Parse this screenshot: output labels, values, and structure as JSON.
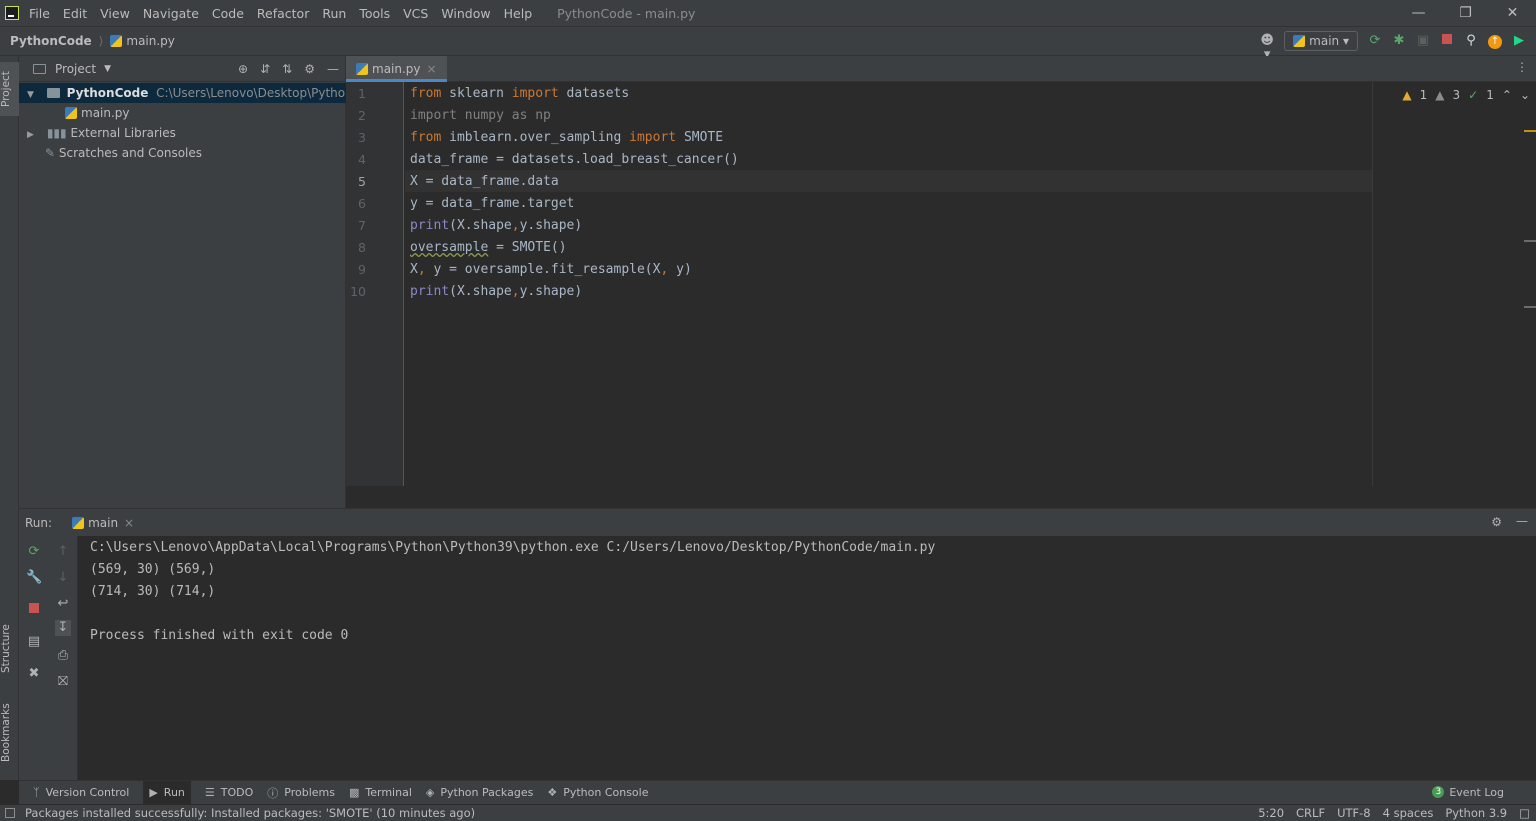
{
  "menu": {
    "items": [
      "File",
      "Edit",
      "View",
      "Navigate",
      "Code",
      "Refactor",
      "Run",
      "Tools",
      "VCS",
      "Window",
      "Help"
    ],
    "window_title": "PythonCode - main.py"
  },
  "navbar": {
    "project": "PythonCode",
    "file": "main.py",
    "run_config": "main"
  },
  "project_panel": {
    "title": "Project",
    "root_name": "PythonCode",
    "root_path": "C:\\Users\\Lenovo\\Desktop\\PythonCode",
    "file": "main.py",
    "external_libraries": "External Libraries",
    "scratches": "Scratches and Consoles"
  },
  "left_stripe": {
    "project": "Project",
    "structure": "Structure",
    "bookmarks": "Bookmarks"
  },
  "editor": {
    "tab": "main.py",
    "line_numbers": [
      "1",
      "2",
      "3",
      "4",
      "5",
      "6",
      "7",
      "8",
      "9",
      "10"
    ],
    "current_line": "5",
    "inspections": {
      "warnings_a": "1",
      "warnings_b": "3",
      "ok": "1"
    },
    "lines": [
      [
        {
          "t": "from",
          "c": "kw"
        },
        {
          "t": " sklearn ",
          "c": ""
        },
        {
          "t": "import",
          "c": "kw"
        },
        {
          "t": " datasets",
          "c": ""
        }
      ],
      [
        {
          "t": "import numpy as np",
          "c": "gray"
        }
      ],
      [
        {
          "t": "from",
          "c": "kw"
        },
        {
          "t": " imblearn.over_sampling ",
          "c": ""
        },
        {
          "t": "import",
          "c": "kw"
        },
        {
          "t": " SMOTE",
          "c": ""
        }
      ],
      [
        {
          "t": "data_frame = datasets.load_breast_cancer()",
          "c": ""
        }
      ],
      [
        {
          "t": "X = data_frame.data",
          "c": ""
        }
      ],
      [
        {
          "t": "y = data_frame.target",
          "c": ""
        }
      ],
      [
        {
          "t": "print",
          "c": "purp"
        },
        {
          "t": "(X.shape",
          "c": ""
        },
        {
          "t": ",",
          "c": "kw"
        },
        {
          "t": "y.shape)",
          "c": ""
        }
      ],
      [
        {
          "t": "oversample",
          "c": "underw"
        },
        {
          "t": " = SMOTE()",
          "c": ""
        }
      ],
      [
        {
          "t": "X",
          "c": ""
        },
        {
          "t": ",",
          "c": "kw"
        },
        {
          "t": " y = oversample.fit_resample(X",
          "c": ""
        },
        {
          "t": ",",
          "c": "kw"
        },
        {
          "t": " y)",
          "c": ""
        }
      ],
      [
        {
          "t": "print",
          "c": "purp"
        },
        {
          "t": "(X.shape",
          "c": ""
        },
        {
          "t": ",",
          "c": "kw"
        },
        {
          "t": "y.shape)",
          "c": ""
        }
      ]
    ]
  },
  "run_panel": {
    "label": "Run:",
    "tab": "main",
    "output": [
      "C:\\Users\\Lenovo\\AppData\\Local\\Programs\\Python\\Python39\\python.exe C:/Users/Lenovo/Desktop/PythonCode/main.py",
      "(569, 30) (569,)",
      "(714, 30) (714,)",
      "",
      "Process finished with exit code 0"
    ]
  },
  "tool_windows": [
    "Version Control",
    "Run",
    "TODO",
    "Problems",
    "Terminal",
    "Python Packages",
    "Python Console"
  ],
  "event_log": {
    "label": "Event Log",
    "count": "3"
  },
  "status": {
    "message": "Packages installed successfully: Installed packages: 'SMOTE' (10 minutes ago)",
    "position": "5:20",
    "line_sep": "CRLF",
    "encoding": "UTF-8",
    "indent": "4 spaces",
    "interpreter": "Python 3.9"
  },
  "colors": {
    "keyword": "#cc7832",
    "builtin": "#8888c6",
    "accent": "#4a88c7",
    "warning": "#e2a935",
    "ok": "#59a869"
  }
}
